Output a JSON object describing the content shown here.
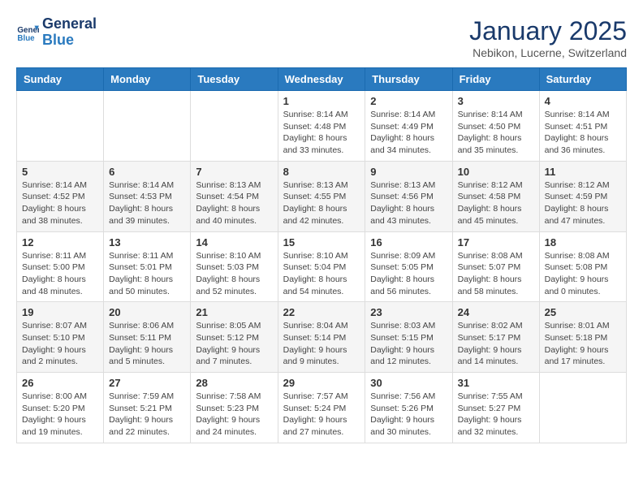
{
  "logo": {
    "line1": "General",
    "line2": "Blue"
  },
  "title": "January 2025",
  "subtitle": "Nebikon, Lucerne, Switzerland",
  "weekdays": [
    "Sunday",
    "Monday",
    "Tuesday",
    "Wednesday",
    "Thursday",
    "Friday",
    "Saturday"
  ],
  "weeks": [
    [
      {
        "day": "",
        "info": ""
      },
      {
        "day": "",
        "info": ""
      },
      {
        "day": "",
        "info": ""
      },
      {
        "day": "1",
        "info": "Sunrise: 8:14 AM\nSunset: 4:48 PM\nDaylight: 8 hours\nand 33 minutes."
      },
      {
        "day": "2",
        "info": "Sunrise: 8:14 AM\nSunset: 4:49 PM\nDaylight: 8 hours\nand 34 minutes."
      },
      {
        "day": "3",
        "info": "Sunrise: 8:14 AM\nSunset: 4:50 PM\nDaylight: 8 hours\nand 35 minutes."
      },
      {
        "day": "4",
        "info": "Sunrise: 8:14 AM\nSunset: 4:51 PM\nDaylight: 8 hours\nand 36 minutes."
      }
    ],
    [
      {
        "day": "5",
        "info": "Sunrise: 8:14 AM\nSunset: 4:52 PM\nDaylight: 8 hours\nand 38 minutes."
      },
      {
        "day": "6",
        "info": "Sunrise: 8:14 AM\nSunset: 4:53 PM\nDaylight: 8 hours\nand 39 minutes."
      },
      {
        "day": "7",
        "info": "Sunrise: 8:13 AM\nSunset: 4:54 PM\nDaylight: 8 hours\nand 40 minutes."
      },
      {
        "day": "8",
        "info": "Sunrise: 8:13 AM\nSunset: 4:55 PM\nDaylight: 8 hours\nand 42 minutes."
      },
      {
        "day": "9",
        "info": "Sunrise: 8:13 AM\nSunset: 4:56 PM\nDaylight: 8 hours\nand 43 minutes."
      },
      {
        "day": "10",
        "info": "Sunrise: 8:12 AM\nSunset: 4:58 PM\nDaylight: 8 hours\nand 45 minutes."
      },
      {
        "day": "11",
        "info": "Sunrise: 8:12 AM\nSunset: 4:59 PM\nDaylight: 8 hours\nand 47 minutes."
      }
    ],
    [
      {
        "day": "12",
        "info": "Sunrise: 8:11 AM\nSunset: 5:00 PM\nDaylight: 8 hours\nand 48 minutes."
      },
      {
        "day": "13",
        "info": "Sunrise: 8:11 AM\nSunset: 5:01 PM\nDaylight: 8 hours\nand 50 minutes."
      },
      {
        "day": "14",
        "info": "Sunrise: 8:10 AM\nSunset: 5:03 PM\nDaylight: 8 hours\nand 52 minutes."
      },
      {
        "day": "15",
        "info": "Sunrise: 8:10 AM\nSunset: 5:04 PM\nDaylight: 8 hours\nand 54 minutes."
      },
      {
        "day": "16",
        "info": "Sunrise: 8:09 AM\nSunset: 5:05 PM\nDaylight: 8 hours\nand 56 minutes."
      },
      {
        "day": "17",
        "info": "Sunrise: 8:08 AM\nSunset: 5:07 PM\nDaylight: 8 hours\nand 58 minutes."
      },
      {
        "day": "18",
        "info": "Sunrise: 8:08 AM\nSunset: 5:08 PM\nDaylight: 9 hours\nand 0 minutes."
      }
    ],
    [
      {
        "day": "19",
        "info": "Sunrise: 8:07 AM\nSunset: 5:10 PM\nDaylight: 9 hours\nand 2 minutes."
      },
      {
        "day": "20",
        "info": "Sunrise: 8:06 AM\nSunset: 5:11 PM\nDaylight: 9 hours\nand 5 minutes."
      },
      {
        "day": "21",
        "info": "Sunrise: 8:05 AM\nSunset: 5:12 PM\nDaylight: 9 hours\nand 7 minutes."
      },
      {
        "day": "22",
        "info": "Sunrise: 8:04 AM\nSunset: 5:14 PM\nDaylight: 9 hours\nand 9 minutes."
      },
      {
        "day": "23",
        "info": "Sunrise: 8:03 AM\nSunset: 5:15 PM\nDaylight: 9 hours\nand 12 minutes."
      },
      {
        "day": "24",
        "info": "Sunrise: 8:02 AM\nSunset: 5:17 PM\nDaylight: 9 hours\nand 14 minutes."
      },
      {
        "day": "25",
        "info": "Sunrise: 8:01 AM\nSunset: 5:18 PM\nDaylight: 9 hours\nand 17 minutes."
      }
    ],
    [
      {
        "day": "26",
        "info": "Sunrise: 8:00 AM\nSunset: 5:20 PM\nDaylight: 9 hours\nand 19 minutes."
      },
      {
        "day": "27",
        "info": "Sunrise: 7:59 AM\nSunset: 5:21 PM\nDaylight: 9 hours\nand 22 minutes."
      },
      {
        "day": "28",
        "info": "Sunrise: 7:58 AM\nSunset: 5:23 PM\nDaylight: 9 hours\nand 24 minutes."
      },
      {
        "day": "29",
        "info": "Sunrise: 7:57 AM\nSunset: 5:24 PM\nDaylight: 9 hours\nand 27 minutes."
      },
      {
        "day": "30",
        "info": "Sunrise: 7:56 AM\nSunset: 5:26 PM\nDaylight: 9 hours\nand 30 minutes."
      },
      {
        "day": "31",
        "info": "Sunrise: 7:55 AM\nSunset: 5:27 PM\nDaylight: 9 hours\nand 32 minutes."
      },
      {
        "day": "",
        "info": ""
      }
    ]
  ]
}
